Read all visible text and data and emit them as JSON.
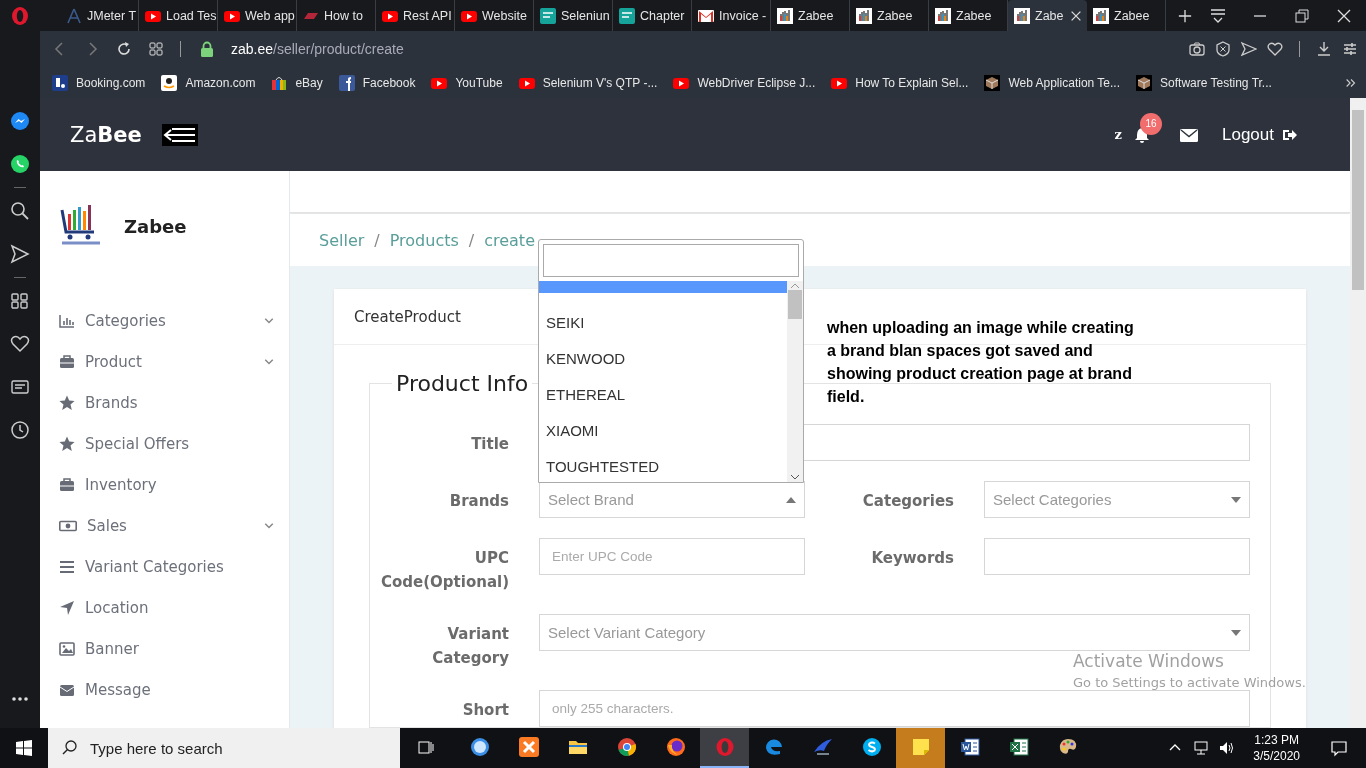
{
  "browser": {
    "tabs": [
      {
        "title": "JMeter T",
        "kind": "feather",
        "selected": false
      },
      {
        "title": "Load Tes",
        "kind": "video",
        "selected": false
      },
      {
        "title": "Web app",
        "kind": "video",
        "selected": false
      },
      {
        "title": "How to",
        "kind": "slash",
        "selected": false
      },
      {
        "title": "Rest API",
        "kind": "video",
        "selected": false
      },
      {
        "title": "Website",
        "kind": "video",
        "selected": false
      },
      {
        "title": "Seleniun",
        "kind": "tile",
        "selected": false
      },
      {
        "title": "Chapter",
        "kind": "tile",
        "selected": false
      },
      {
        "title": "Invoice -",
        "kind": "mail",
        "selected": false
      },
      {
        "title": "Zabee",
        "kind": "bars",
        "selected": false
      },
      {
        "title": "Zabee",
        "kind": "bars",
        "selected": false
      },
      {
        "title": "Zabee",
        "kind": "bars",
        "selected": false
      },
      {
        "title": "Zabe",
        "kind": "bars",
        "selected": true
      },
      {
        "title": "Zabee",
        "kind": "bars",
        "selected": false
      }
    ],
    "address": {
      "host": "zab.ee",
      "path": "/seller/product/create"
    },
    "bookmarks": [
      {
        "label": "Booking.com",
        "kind": "booking"
      },
      {
        "label": "Amazon.com",
        "kind": "amazon"
      },
      {
        "label": "eBay",
        "kind": "bag"
      },
      {
        "label": "Facebook",
        "kind": "facebook"
      },
      {
        "label": "YouTube",
        "kind": "video"
      },
      {
        "label": "Selenium V's QTP -...",
        "kind": "video"
      },
      {
        "label": "WebDriver Eclipse J...",
        "kind": "video"
      },
      {
        "label": "How To Explain Sel...",
        "kind": "video"
      },
      {
        "label": "Web Application Te...",
        "kind": "cube"
      },
      {
        "label": "Software Testing Tr...",
        "kind": "cube"
      }
    ]
  },
  "header": {
    "logo": "Za**Bee**",
    "user": "z",
    "notifications": "16",
    "logout": "Logout"
  },
  "sidebar": {
    "brand": "Zabee",
    "items": [
      {
        "label": "Categories",
        "kind": "chart",
        "expandable": true
      },
      {
        "label": "Product",
        "kind": "briefcase",
        "expandable": true
      },
      {
        "label": "Brands",
        "kind": "star",
        "expandable": false
      },
      {
        "label": "Special Offers",
        "kind": "star",
        "expandable": false
      },
      {
        "label": "Inventory",
        "kind": "briefcase",
        "expandable": false
      },
      {
        "label": "Sales",
        "kind": "money",
        "expandable": true
      },
      {
        "label": "Variant Categories",
        "kind": "lines",
        "expandable": false
      },
      {
        "label": "Location",
        "kind": "arrow",
        "expandable": false
      },
      {
        "label": "Banner",
        "kind": "image",
        "expandable": false
      },
      {
        "label": "Message",
        "kind": "envelope",
        "expandable": false
      }
    ]
  },
  "breadcrumb": [
    {
      "kind": "link",
      "text": "Seller"
    },
    {
      "kind": "separator",
      "text": "/"
    },
    {
      "kind": "link",
      "text": "Products"
    },
    {
      "kind": "separator",
      "text": "/"
    },
    {
      "kind": "current",
      "text": "create"
    }
  ],
  "card": {
    "title": "CreateProduct",
    "legend": "Product Info"
  },
  "form": {
    "rows": [
      {
        "fields": [
          {
            "label": "Title",
            "kind": "input"
          }
        ]
      },
      {
        "fields": [
          {
            "label": "Brands",
            "kind": "select",
            "placeholder": "Select Brand",
            "open": true
          },
          {
            "label": "Categories",
            "kind": "select",
            "placeholder": "Select Categories",
            "open": false
          }
        ]
      },
      {
        "fields": [
          {
            "label": "UPC Code(Optional)",
            "kind": "input",
            "placeholder": "Enter UPC Code"
          },
          {
            "label": "Keywords",
            "kind": "input"
          }
        ]
      },
      {
        "fields": [
          {
            "label": "Variant Category",
            "kind": "select",
            "placeholder": "Select Variant Category",
            "open": false
          }
        ]
      },
      {
        "fields": [
          {
            "label": "Short",
            "kind": "textarea",
            "placeholder": "only 255 characters."
          }
        ]
      }
    ]
  },
  "dropdown": {
    "options": [
      {
        "selected": true
      },
      {
        "label": "SEIKI",
        "selected": false
      },
      {
        "label": "KENWOOD",
        "selected": false
      },
      {
        "label": "ETHEREAL",
        "selected": false
      },
      {
        "label": "XIAOMI",
        "selected": false
      },
      {
        "label": "TOUGHTESTED",
        "selected": false
      }
    ]
  },
  "annotation": "when uploading an image while creating a brand blan spaces got saved and showing product creation page at brand field.",
  "activation": {
    "title": "Activate Windows",
    "subtitle": "Go to Settings to activate Windows."
  },
  "taskbar": {
    "search": {
      "placeholder": "Type here to search"
    },
    "apps": [
      {
        "kind": "compass",
        "selected": false,
        "flashing": false
      },
      {
        "kind": "xampp",
        "selected": false,
        "flashing": false
      },
      {
        "kind": "folder",
        "selected": false,
        "flashing": false
      },
      {
        "kind": "chrome",
        "selected": false,
        "flashing": false
      },
      {
        "kind": "firefox",
        "selected": false,
        "flashing": false
      },
      {
        "kind": "opera",
        "selected": true,
        "flashing": false
      },
      {
        "kind": "edge",
        "selected": false,
        "flashing": false
      },
      {
        "kind": "bird",
        "selected": false,
        "flashing": false
      },
      {
        "kind": "skype",
        "selected": false,
        "flashing": false
      },
      {
        "kind": "note",
        "selected": false,
        "flashing": true
      },
      {
        "kind": "word",
        "selected": false,
        "flashing": false
      },
      {
        "kind": "excel",
        "selected": false,
        "flashing": false
      },
      {
        "kind": "palette",
        "selected": false,
        "flashing": false
      }
    ],
    "time": "1:23 PM",
    "date": "3/5/2020"
  }
}
